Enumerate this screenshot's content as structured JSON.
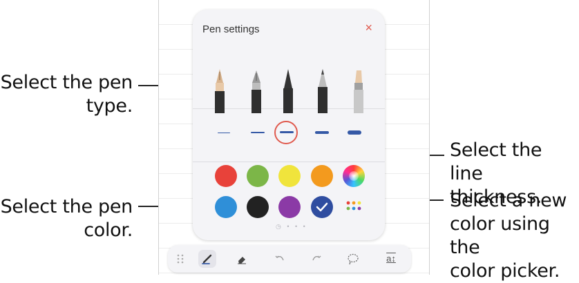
{
  "pen_settings": {
    "title": "Pen settings",
    "close_glyph": "×",
    "pen_types": [
      "fountain-pen",
      "calligraphy-pen",
      "pen",
      "pencil",
      "highlighter"
    ],
    "selected_pen": "fountain-pen",
    "line_thickness_levels": 5,
    "selected_thickness_level": 3,
    "colors": [
      "#e8423a",
      "#7cb648",
      "#f0e43c",
      "#f39a1e",
      "rainbow",
      "#2f8fd8",
      "#222222",
      "#8b3aa6",
      "#2f4da0",
      "palette"
    ],
    "selected_color": "#2f4da0",
    "page_indicator": "◷ • • •"
  },
  "toolbar": {
    "icons": [
      "drag-handle-icon",
      "pen-icon",
      "eraser-icon",
      "undo-icon",
      "redo-icon",
      "lasso-icon",
      "text-fit-icon"
    ],
    "text_fit_label": "a↕"
  },
  "callouts": {
    "pen_type": [
      "Select the pen",
      "type."
    ],
    "pen_color": [
      "Select the pen",
      "color."
    ],
    "line_thickness": [
      "Select the line",
      "thickness."
    ],
    "color_picker": [
      "Select a new",
      "color using the",
      "color picker."
    ]
  }
}
